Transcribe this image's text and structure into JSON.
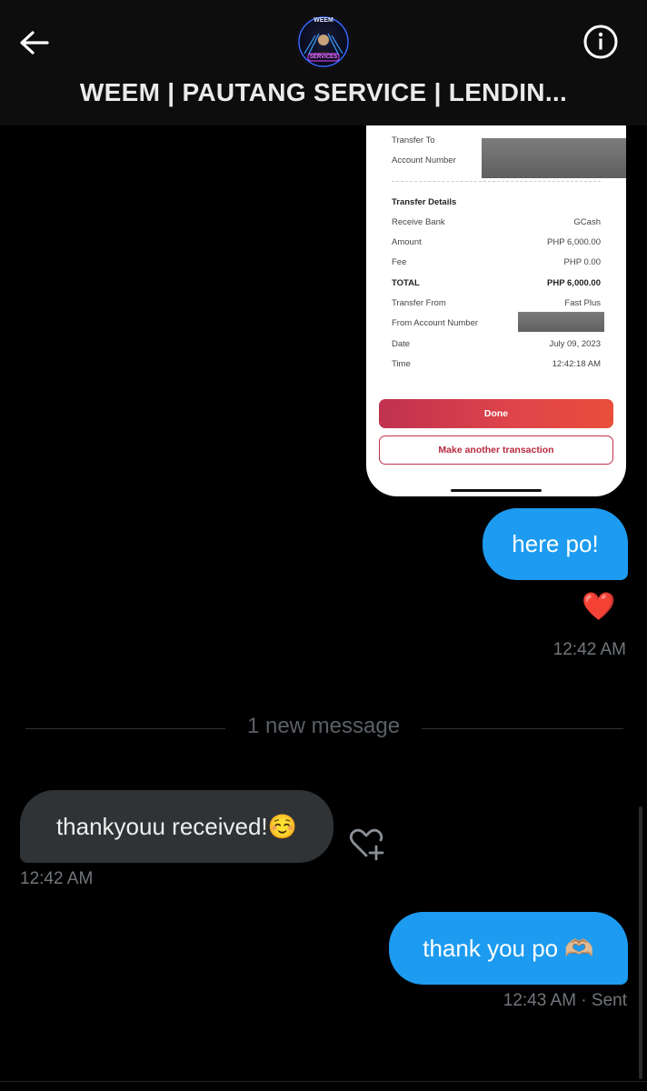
{
  "header": {
    "title": "WEEM | PAUTANG SERVICE | LENDIN...",
    "avatar_text_top": "WEEM",
    "avatar_text_bottom": "SERVICES"
  },
  "receipt": {
    "transfer_to_label": "Transfer To",
    "account_number_label": "Account Number",
    "details_heading": "Transfer Details",
    "rows": [
      {
        "label": "Receive Bank",
        "value": "GCash"
      },
      {
        "label": "Amount",
        "value": "PHP 6,000.00"
      },
      {
        "label": "Fee",
        "value": "PHP 0.00"
      },
      {
        "label": "TOTAL",
        "value": "PHP 6,000.00"
      },
      {
        "label": "Transfer From",
        "value": "Fast Plus"
      },
      {
        "label": "From Account Number",
        "value": ""
      },
      {
        "label": "Date",
        "value": "July 09, 2023"
      },
      {
        "label": "Time",
        "value": "12:42:18 AM"
      }
    ],
    "done_label": "Done",
    "another_label": "Make another transaction"
  },
  "messages": {
    "sent_1": "here po!",
    "reaction": "❤️",
    "sent_1_time": "12:42 AM",
    "new_message_divider": "1 new message",
    "received_1": "thankyouu received!☺️",
    "received_1_time": "12:42 AM",
    "sent_2": "thank you po 🫶🏼",
    "sent_2_status": "12:43 AM · Sent"
  },
  "colors": {
    "sent_bubble": "#1d9bf0",
    "received_bubble": "#2f3336",
    "accent_red": "#c0324e"
  }
}
